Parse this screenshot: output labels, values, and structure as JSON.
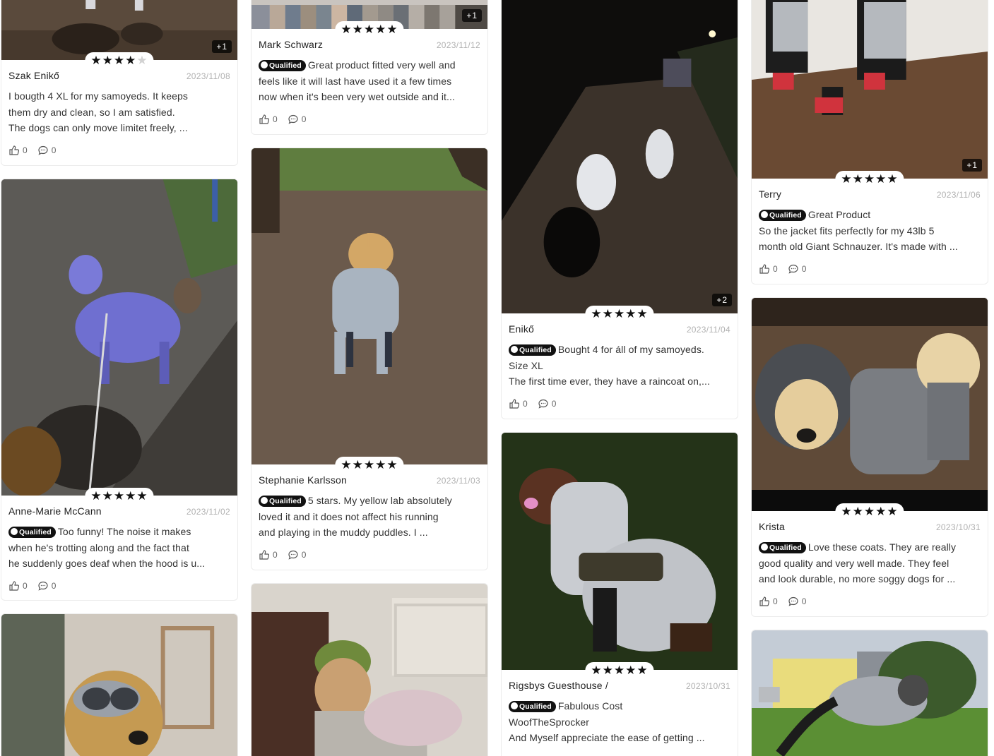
{
  "reviews": [
    {
      "author": "Szak Enikő",
      "date": "2023/11/08",
      "stars": 4,
      "qualified": false,
      "badge": "+1",
      "lines": [
        "I bougth 4 XL for my samoyeds. It keeps",
        "them dry and clean, so I am satisfied.",
        "The dogs can only move limitet freely, ..."
      ],
      "likes": "0",
      "comments": "0"
    },
    {
      "author": "Anne-Marie McCann",
      "date": "2023/11/02",
      "stars": 5,
      "qualified": true,
      "lines": [
        "Too funny! The noise it makes",
        "when he's trotting along and the fact that",
        "he suddenly goes deaf when the hood is u..."
      ],
      "likes": "0",
      "comments": "0"
    },
    {
      "author": "Mark Schwarz",
      "date": "2023/11/12",
      "stars": 5,
      "qualified": true,
      "badge": "+1",
      "lines": [
        "Great product fitted very well and",
        "feels like it will last have used it a few times",
        "now when it's been very wet outside and it..."
      ],
      "likes": "0",
      "comments": "0"
    },
    {
      "author": "Stephanie Karlsson",
      "date": "2023/11/03",
      "stars": 5,
      "qualified": true,
      "lines": [
        "5 stars. My yellow lab absolutely",
        "loved it and it does not affect his running",
        "and playing in the muddy puddles. I ..."
      ],
      "likes": "0",
      "comments": "0"
    },
    {
      "author": "Enikő",
      "date": "2023/11/04",
      "stars": 5,
      "qualified": true,
      "badge": "+2",
      "lines": [
        "Bought 4 for áll of my samoyeds.",
        "Size XL",
        "The first time ever, they have a raincoat on,..."
      ],
      "likes": "0",
      "comments": "0"
    },
    {
      "author": "Rigsbys Guesthouse /",
      "date": "2023/10/31",
      "stars": 5,
      "qualified": true,
      "lines": [
        "Fabulous Cost",
        "WoofTheSprocker",
        "And Myself appreciate the ease of getting ..."
      ]
    },
    {
      "author": "Terry",
      "date": "2023/11/06",
      "stars": 5,
      "qualified": true,
      "badge": "+1",
      "lines": [
        "Great Product",
        "So the jacket fits perfectly for my 43lb 5",
        "month old Giant Schnauzer. It's made with ..."
      ],
      "likes": "0",
      "comments": "0"
    },
    {
      "author": "Krista",
      "date": "2023/10/31",
      "stars": 5,
      "qualified": true,
      "lines": [
        "Love these coats.  They are really",
        "good quality and very well made.  They feel",
        "and look durable, no more soggy dogs for ..."
      ],
      "likes": "0",
      "comments": "0"
    }
  ],
  "qualified_label": "Qualified",
  "icons": {
    "like": "thumbs-up-icon",
    "comment": "comment-bubble-icon",
    "star_filled": "★",
    "star_empty": "★"
  },
  "colors": {
    "badge_bg": "#111111",
    "date": "#b1b1b1",
    "star": "#111111",
    "star_empty": "#d2d2d2"
  }
}
